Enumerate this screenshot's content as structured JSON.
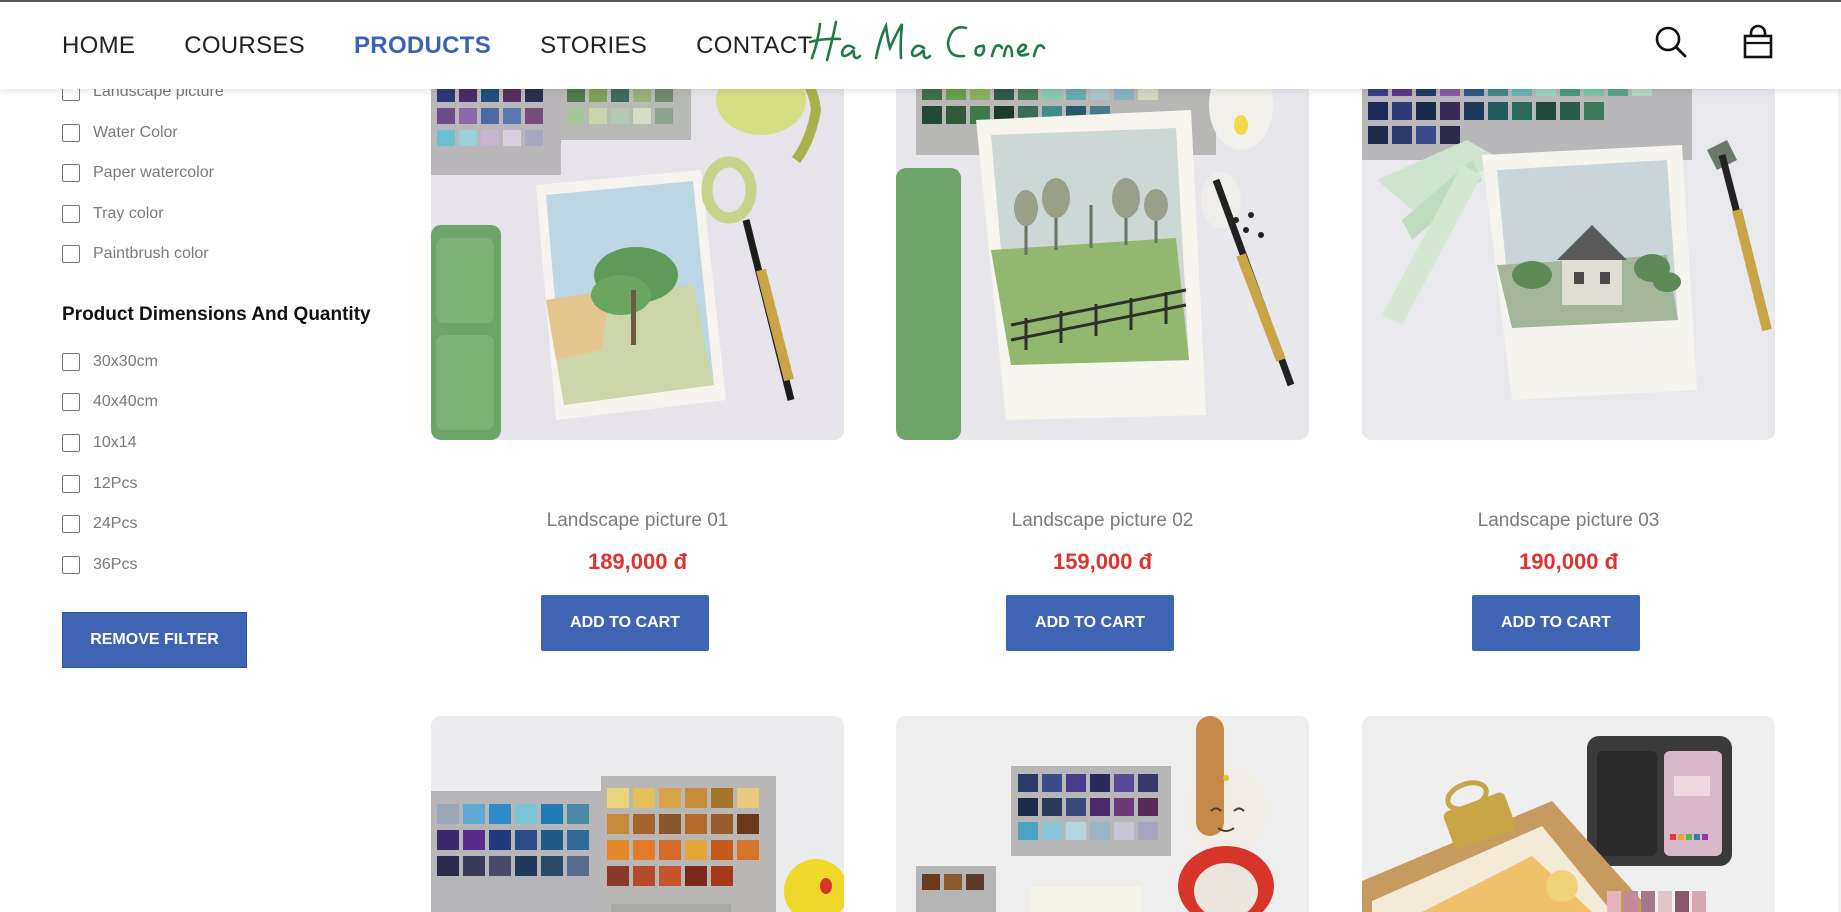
{
  "nav": {
    "items": [
      {
        "label": "HOME",
        "active": false
      },
      {
        "label": "COURSES",
        "active": false
      },
      {
        "label": "PRODUCTS",
        "active": true
      },
      {
        "label": "STORIES",
        "active": false
      },
      {
        "label": "CONTACT",
        "active": false
      }
    ],
    "logo_text": "Ha Ma Corner",
    "icons": [
      "search-icon",
      "shopping-bag-icon"
    ]
  },
  "sidebar": {
    "category_filters": [
      {
        "label": "Landscape picture",
        "checked": false
      },
      {
        "label": "Water Color",
        "checked": false
      },
      {
        "label": "Paper watercolor",
        "checked": false
      },
      {
        "label": "Tray color",
        "checked": false
      },
      {
        "label": "Paintbrush color",
        "checked": false
      }
    ],
    "dimensions_title": "Product Dimensions And Quantity",
    "dimension_filters": [
      {
        "label": "30x30cm",
        "checked": false
      },
      {
        "label": "40x40cm",
        "checked": false
      },
      {
        "label": "10x14",
        "checked": false
      },
      {
        "label": "12Pcs",
        "checked": false
      },
      {
        "label": "24Pcs",
        "checked": false
      },
      {
        "label": "36Pcs",
        "checked": false
      }
    ],
    "remove_filter_label": "REMOVE FILTER"
  },
  "products": [
    {
      "name": "Landscape picture 01",
      "price": "189,000 đ",
      "button": "ADD TO CART"
    },
    {
      "name": "Landscape picture 02",
      "price": "159,000 đ",
      "button": "ADD TO CART"
    },
    {
      "name": "Landscape picture 03",
      "price": "190,000 đ",
      "button": "ADD TO CART"
    }
  ],
  "colors": {
    "accent": "#3f64b3",
    "price": "#e0322f",
    "logo": "#1f7a46"
  }
}
